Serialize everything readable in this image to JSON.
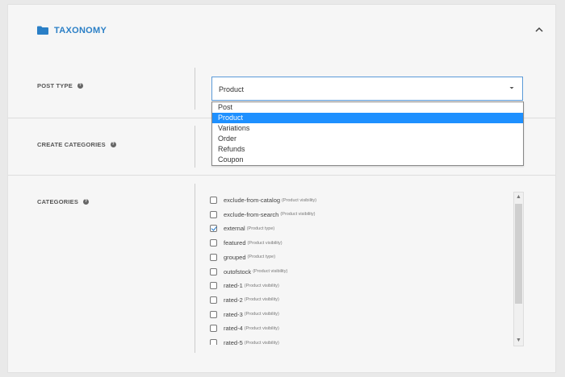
{
  "section": {
    "title": "TAXONOMY",
    "folder_icon": "folder-icon",
    "collapse_icon": "chevron-up-icon",
    "accent": "#2a7fc6"
  },
  "post_type": {
    "label": "POST TYPE",
    "value": "Product",
    "options": [
      "Post",
      "Product",
      "Variations",
      "Order",
      "Refunds",
      "Coupon"
    ],
    "selected_index": 1
  },
  "create_categories": {
    "label": "CREATE CATEGORIES"
  },
  "categories": {
    "label": "CATEGORIES",
    "items": [
      {
        "name": "exclude-from-catalog",
        "type": "(Product visibility)",
        "checked": false
      },
      {
        "name": "exclude-from-search",
        "type": "(Product visibility)",
        "checked": false
      },
      {
        "name": "external",
        "type": "(Product type)",
        "checked": true
      },
      {
        "name": "featured",
        "type": "(Product visibility)",
        "checked": false
      },
      {
        "name": "grouped",
        "type": "(Product type)",
        "checked": false
      },
      {
        "name": "outofstock",
        "type": "(Product visibility)",
        "checked": false
      },
      {
        "name": "rated-1",
        "type": "(Product visibility)",
        "checked": false
      },
      {
        "name": "rated-2",
        "type": "(Product visibility)",
        "checked": false
      },
      {
        "name": "rated-3",
        "type": "(Product visibility)",
        "checked": false
      },
      {
        "name": "rated-4",
        "type": "(Product visibility)",
        "checked": false
      },
      {
        "name": "rated-5",
        "type": "(Product visibility)",
        "checked": false
      }
    ]
  },
  "help_icon": "question-icon"
}
